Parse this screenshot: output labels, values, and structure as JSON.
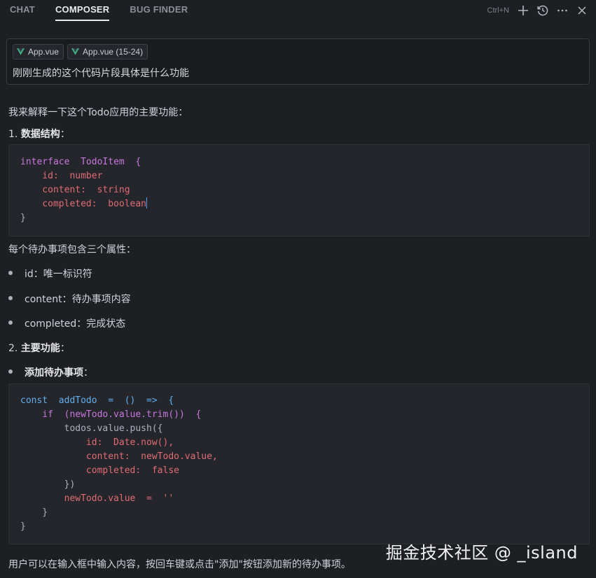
{
  "tabs": [
    {
      "label": "CHAT",
      "active": false
    },
    {
      "label": "COMPOSER",
      "active": true
    },
    {
      "label": "BUG FINDER",
      "active": false
    }
  ],
  "toolbar": {
    "shortcut": "Ctrl+N",
    "icons": [
      "plus-icon",
      "history-icon",
      "more-icon",
      "close-icon"
    ]
  },
  "composer": {
    "chips": [
      {
        "label": "App.vue",
        "icon": "vue-icon"
      },
      {
        "label": "App.vue (15-24)",
        "icon": "vue-icon"
      }
    ],
    "prompt": "刚刚生成的这个代码片段具体是什么功能"
  },
  "response": {
    "intro": "我来解释一下这个Todo应用的主要功能：",
    "section1": {
      "num": "1. ",
      "title": "数据结构",
      "colon": "："
    },
    "code1": [
      "interface  TodoItem  {",
      "    id:  number",
      "    content:  string",
      "    completed:  boolean",
      "}"
    ],
    "para1": "每个待办事项包含三个属性：",
    "bullets1": [
      "id：唯一标识符",
      "content：待办事项内容",
      "completed：完成状态"
    ],
    "section2": {
      "num": "2. ",
      "title": "主要功能",
      "colon": "："
    },
    "bullet2": {
      "title": "添加待办事项",
      "colon": "："
    },
    "code2": [
      "const  addTodo  =  ()  =>  {",
      "    if  (newTodo.value.trim())  {",
      "        todos.value.push({",
      "            id:  Date.now(),",
      "            content:  newTodo.value,",
      "            completed:  false",
      "        })",
      "        newTodo.value  =  ''",
      "    }",
      "}"
    ],
    "outro": "用户可以在输入框中输入内容，按回车键或点击\"添加\"按钮添加新的待办事项。"
  },
  "watermark": "掘金技术社区 @ _island",
  "colors": {
    "background": "#1e1f23",
    "keyword": "#c678dd",
    "type": "#e5c07b",
    "property": "#e06c75",
    "function": "#61afef",
    "vue_green": "#42b883"
  }
}
